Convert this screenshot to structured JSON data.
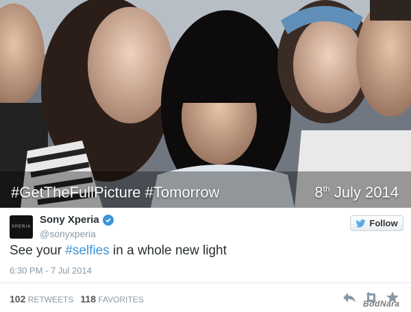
{
  "photo": {
    "caption_left": "#GetTheFullPicture #Tomorrow",
    "date_day": "8",
    "date_suffix": "th",
    "date_rest": "July 2014"
  },
  "tweet": {
    "avatar_text": "XPERIA",
    "name": "Sony Xperia",
    "handle": "@sonyxperia",
    "follow_label": "Follow",
    "text_before": "See your ",
    "hashtag": "#selfies",
    "text_after": " in a whole new light",
    "timestamp": "6:30 PM - 7 Jul 2014",
    "retweets_count": "102",
    "retweets_label": "RETWEETS",
    "favorites_count": "118",
    "favorites_label": "FAVORITES"
  },
  "watermark": "BodNara",
  "colors": {
    "link": "#3b94d9",
    "verified": "#3b94d9",
    "muted": "#8899a6"
  },
  "icons": [
    "verified-icon",
    "twitter-bird-icon",
    "reply-icon",
    "retweet-icon",
    "favorite-icon"
  ]
}
